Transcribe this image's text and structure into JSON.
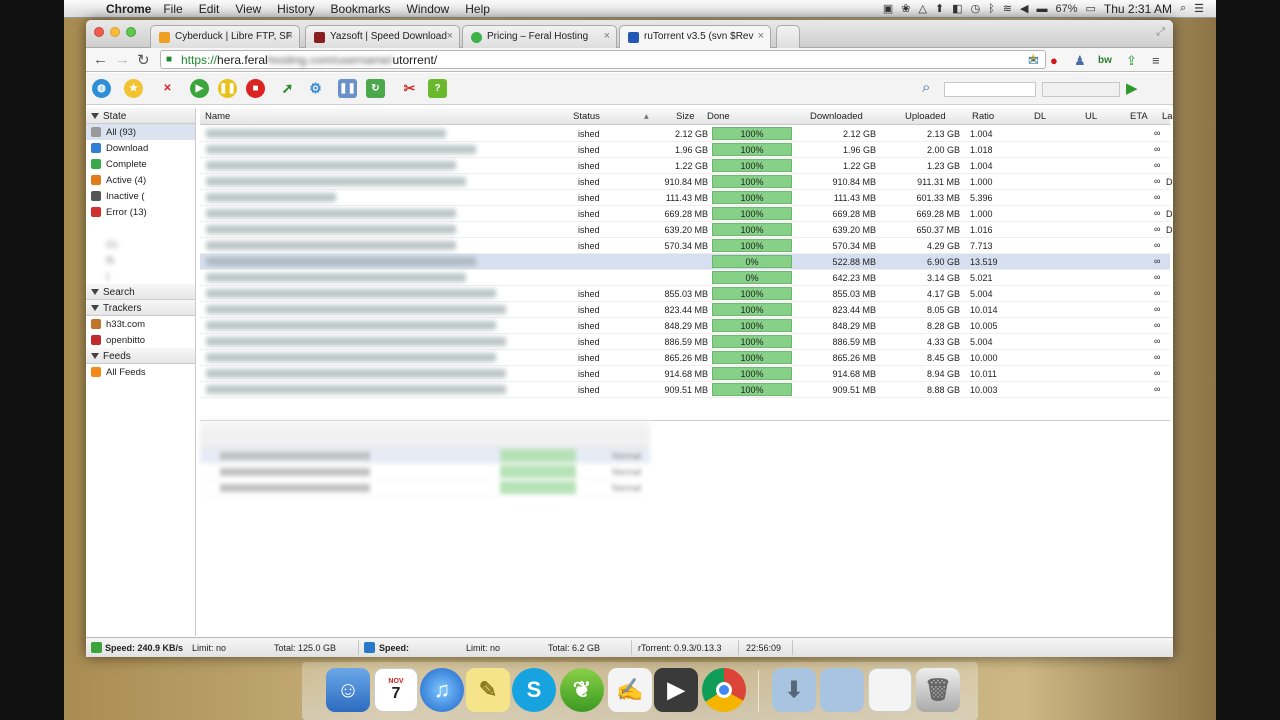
{
  "menubar": {
    "app": "Chrome",
    "items": [
      "File",
      "Edit",
      "View",
      "History",
      "Bookmarks",
      "Window",
      "Help"
    ],
    "battery": "67%",
    "clock": "Thu 2:31 AM"
  },
  "tabs": [
    {
      "label": "Cyberduck | Libre FTP, SF",
      "color": "#f0a020"
    },
    {
      "label": "Yazsoft | Speed Download",
      "color": "#8a1d1d"
    },
    {
      "label": "Pricing – Feral Hosting",
      "color": "#3bb24a"
    },
    {
      "label": "ruTorrent v3.5 (svn $Rev",
      "color": "#2357b5"
    }
  ],
  "address": {
    "scheme": "https://",
    "host": "hera.feral",
    "blurred": "hosting.com/username/",
    "path": "utorrent/"
  },
  "sidebar": {
    "state_title": "State",
    "state_items": [
      {
        "label": "All (93)",
        "color": "#9a9a9a"
      },
      {
        "label": "Download",
        "color": "#2f7fd6"
      },
      {
        "label": "Complete",
        "color": "#38a848"
      },
      {
        "label": "Active (4)",
        "color": "#e07b1a"
      },
      {
        "label": "Inactive (",
        "color": "#555555"
      },
      {
        "label": "Error (13)",
        "color": "#d23030"
      }
    ],
    "ghost_items": [
      "(1)",
      "8)",
      ")"
    ],
    "search_title": "Search",
    "trackers_title": "Trackers",
    "trackers": [
      {
        "label": "h33t.com",
        "color": "#c0762a"
      },
      {
        "label": "openbitto",
        "color": "#c02a2a"
      }
    ],
    "feeds_title": "Feeds",
    "feeds": [
      {
        "label": "All Feeds",
        "color": "#f08a1a"
      }
    ]
  },
  "table": {
    "headers": {
      "name": "Name",
      "status": "Status",
      "size": "Size",
      "done": "Done",
      "downloaded": "Downloaded",
      "uploaded": "Uploaded",
      "ratio": "Ratio",
      "dl": "DL",
      "ul": "UL",
      "eta": "ETA",
      "la": "La"
    },
    "rows": [
      {
        "status": "ished",
        "size": "2.12 GB",
        "done": "100%",
        "downloaded": "2.12 GB",
        "uploaded": "2.13 GB",
        "ratio": "1.004",
        "eta": "∞",
        "extra": ""
      },
      {
        "status": "ished",
        "size": "1.96 GB",
        "done": "100%",
        "downloaded": "1.96 GB",
        "uploaded": "2.00 GB",
        "ratio": "1.018",
        "eta": "∞",
        "extra": ""
      },
      {
        "status": "ished",
        "size": "1.22 GB",
        "done": "100%",
        "downloaded": "1.22 GB",
        "uploaded": "1.23 GB",
        "ratio": "1.004",
        "eta": "∞",
        "extra": ""
      },
      {
        "status": "ished",
        "size": "910.84 MB",
        "done": "100%",
        "downloaded": "910.84 MB",
        "uploaded": "911.31 MB",
        "ratio": "1.000",
        "eta": "∞",
        "extra": "D"
      },
      {
        "status": "ished",
        "size": "111.43 MB",
        "done": "100%",
        "downloaded": "111.43 MB",
        "uploaded": "601.33 MB",
        "ratio": "5.396",
        "eta": "∞",
        "extra": ""
      },
      {
        "status": "ished",
        "size": "669.28 MB",
        "done": "100%",
        "downloaded": "669.28 MB",
        "uploaded": "669.28 MB",
        "ratio": "1.000",
        "eta": "∞",
        "extra": "D"
      },
      {
        "status": "ished",
        "size": "639.20 MB",
        "done": "100%",
        "downloaded": "639.20 MB",
        "uploaded": "650.37 MB",
        "ratio": "1.016",
        "eta": "∞",
        "extra": "D"
      },
      {
        "status": "ished",
        "size": "570.34 MB",
        "done": "100%",
        "downloaded": "570.34 MB",
        "uploaded": "4.29 GB",
        "ratio": "7.713",
        "eta": "∞",
        "extra": ""
      },
      {
        "status": "",
        "size": "",
        "done": "0%",
        "downloaded": "522.88 MB",
        "uploaded": "6.90 GB",
        "ratio": "13.519",
        "eta": "∞",
        "extra": "",
        "hl": true
      },
      {
        "status": "",
        "size": "",
        "done": "0%",
        "downloaded": "642.23 MB",
        "uploaded": "3.14 GB",
        "ratio": "5.021",
        "eta": "∞",
        "extra": ""
      },
      {
        "status": "ished",
        "size": "855.03 MB",
        "done": "100%",
        "downloaded": "855.03 MB",
        "uploaded": "4.17 GB",
        "ratio": "5.004",
        "eta": "∞",
        "extra": ""
      },
      {
        "status": "ished",
        "size": "823.44 MB",
        "done": "100%",
        "downloaded": "823.44 MB",
        "uploaded": "8.05 GB",
        "ratio": "10.014",
        "eta": "∞",
        "extra": ""
      },
      {
        "status": "ished",
        "size": "848.29 MB",
        "done": "100%",
        "downloaded": "848.29 MB",
        "uploaded": "8.28 GB",
        "ratio": "10.005",
        "eta": "∞",
        "extra": ""
      },
      {
        "status": "ished",
        "size": "886.59 MB",
        "done": "100%",
        "downloaded": "886.59 MB",
        "uploaded": "4.33 GB",
        "ratio": "5.004",
        "eta": "∞",
        "extra": ""
      },
      {
        "status": "ished",
        "size": "865.26 MB",
        "done": "100%",
        "downloaded": "865.26 MB",
        "uploaded": "8.45 GB",
        "ratio": "10.000",
        "eta": "∞",
        "extra": ""
      },
      {
        "status": "ished",
        "size": "914.68 MB",
        "done": "100%",
        "downloaded": "914.68 MB",
        "uploaded": "8.94 GB",
        "ratio": "10.011",
        "eta": "∞",
        "extra": ""
      },
      {
        "status": "ished",
        "size": "909.51 MB",
        "done": "100%",
        "downloaded": "909.51 MB",
        "uploaded": "8.88 GB",
        "ratio": "10.003",
        "eta": "∞",
        "extra": ""
      }
    ]
  },
  "lower_panel": {
    "rows": [
      {
        "label": "Normal"
      },
      {
        "label": "Normal"
      },
      {
        "label": "Normal"
      }
    ]
  },
  "statusbar": {
    "dl_speed": "Speed: 240.9 KB/s",
    "dl_limit": "Limit: no",
    "dl_total": "Total: 125.0 GB",
    "ul_speed": "Speed:",
    "ul_limit": "Limit: no",
    "ul_total": "Total: 6.2 GB",
    "version": "rTorrent: 0.9.3/0.13.3",
    "time": "22:56:09"
  },
  "dock": {
    "calendar_month": "NOV",
    "calendar_day": "7"
  },
  "colors": {
    "progress_fill": "#86d087",
    "selection": "#d6dff0"
  }
}
